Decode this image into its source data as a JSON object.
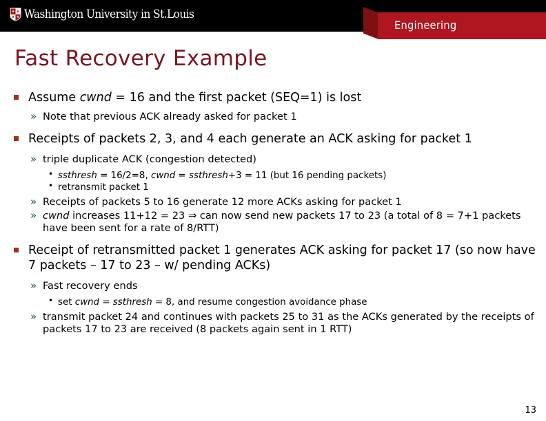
{
  "header": {
    "logo_text": "Washington University in St.Louis",
    "shield_icon": "shield-crest-icon",
    "ribbon_label": "Engineering",
    "bar_color": "#000000",
    "ribbon_color": "#b01620",
    "ribbon_fold_color": "#7d1012"
  },
  "title": {
    "text": "Fast Recovery Example",
    "color": "#7b1520"
  },
  "markers": {
    "level1": "square-bullet-icon",
    "level1_color": "#9b3310",
    "level2": "»",
    "level2_color": "#1f5c27",
    "level3": "•"
  },
  "content": {
    "b1": {
      "pre": "Assume ",
      "var1": "cwnd",
      "post": " = 16 and the first packet (SEQ=1) is lost"
    },
    "b1s1": "Note that previous ACK already asked for packet 1",
    "b2": "Receipts of packets 2, 3, and 4 each generate an ACK asking for packet 1",
    "b2s1": "triple duplicate ACK (congestion detected)",
    "b2s1a": {
      "var1": "ssthresh",
      "mid1": " = 16/2=8, ",
      "var2": "cwnd",
      "mid2": " = ",
      "var3": "ssthresh",
      "post": "+3 = 11 (but 16 pending packets)"
    },
    "b2s1b": "retransmit packet 1",
    "b2s2": "Receipts of packets 5 to 16 generate 12 more ACKs asking for packet 1",
    "b2s3": {
      "var1": "cwnd",
      "post": " increases 11+12 = 23 ⇒ can now send new packets 17 to 23 (a total of 8 = 7+1 packets have been sent for a rate of 8/RTT)"
    },
    "b3": "Receipt of retransmitted packet 1 generates ACK asking for packet 17 (so now have 7 packets – 17 to 23 – w/ pending ACKs)",
    "b3s1": "Fast recovery ends",
    "b3s1a": {
      "pre": "set ",
      "var1": "cwnd",
      "mid1": " = ",
      "var2": "ssthresh",
      "post": " = 8, and resume congestion avoidance phase"
    },
    "b3s2": "transmit packet 24 and continues with packets 25 to 31 as the ACKs generated by the receipts of packets 17 to 23 are received (8 packets again sent in 1 RTT)"
  },
  "footer": {
    "page_number": "13"
  }
}
